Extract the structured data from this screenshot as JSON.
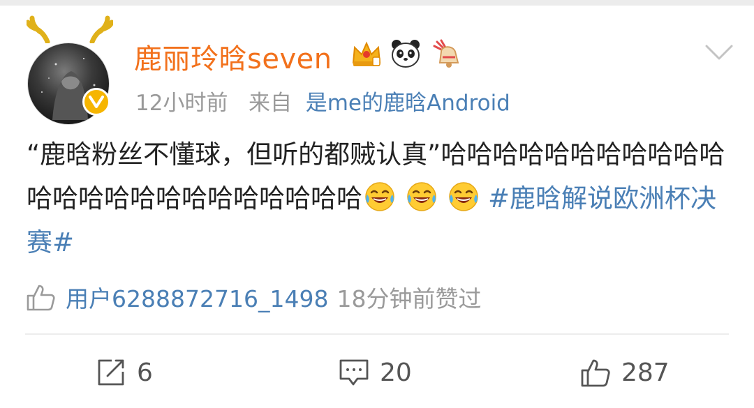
{
  "post": {
    "author": {
      "name": "鹿丽玲晗seven",
      "avatar_alt": "avatar",
      "verified_icon": "verified-v-icon",
      "badge_icons": [
        "crown-vip-icon",
        "panda-icon",
        "festival-bell-icon"
      ]
    },
    "time": "12小时前",
    "source_prefix": "来自",
    "source": "是me的鹿晗Android",
    "text": "“鹿晗粉丝不懂球，但听的都贼认真”哈哈哈哈哈哈哈哈哈哈哈哈哈哈哈哈哈哈哈哈哈哈哈哈",
    "emoji_icons": [
      "laugh-cry-emoji",
      "laugh-cry-emoji",
      "laugh-cry-emoji"
    ],
    "hashtag": "#鹿晗解说欧洲杯决赛#"
  },
  "liked_by": {
    "user": "用户6288872716_1498",
    "suffix": "18分钟前赞过"
  },
  "actions": {
    "repost_count": "6",
    "comment_count": "20",
    "like_count": "287"
  },
  "colors": {
    "username": "#f2711c",
    "link": "#4a7fb5",
    "meta": "#9a9a9a",
    "text": "#222222",
    "verified": "#f6b500"
  }
}
